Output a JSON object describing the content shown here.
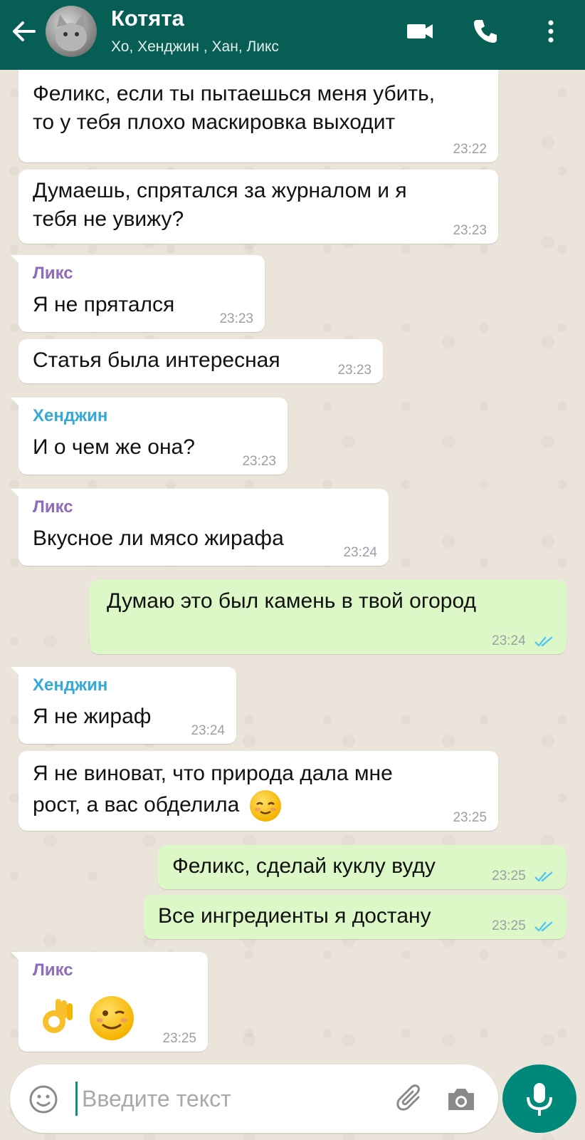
{
  "header": {
    "title": "Котята",
    "members": "Хо, Хенджин , Хан, Ликс"
  },
  "messages": [
    {
      "dir": "in",
      "sender": "",
      "text_lines": [
        "Феликс, если ты пытаешься меня убить,",
        "то у тебя плохо маскировка выходит"
      ],
      "time": "23:22"
    },
    {
      "dir": "in",
      "sender": "",
      "text_lines": [
        "Думаешь, спрятался за журналом и я",
        "тебя не увижу?"
      ],
      "time": "23:23"
    },
    {
      "dir": "in",
      "sender": "Ликс",
      "text_lines": [
        "Я не прятался"
      ],
      "time": "23:23"
    },
    {
      "dir": "in",
      "sender": "",
      "text_lines": [
        "Статья была интересная"
      ],
      "time": "23:23"
    },
    {
      "dir": "in",
      "sender": "Хенджин",
      "text_lines": [
        "И о чем же она?"
      ],
      "time": "23:23"
    },
    {
      "dir": "in",
      "sender": "Ликс",
      "text_lines": [
        "Вкусное ли мясо жирафа"
      ],
      "time": "23:24"
    },
    {
      "dir": "out",
      "sender": "",
      "text_lines": [
        "Думаю это был камень в твой огород"
      ],
      "time": "23:24"
    },
    {
      "dir": "in",
      "sender": "Хенджин",
      "text_lines": [
        "Я не жираф"
      ],
      "time": "23:24"
    },
    {
      "dir": "in",
      "sender": "",
      "text_lines": [
        "Я не виноват, что природа дала мне",
        "рост, а вас обделила"
      ],
      "time": "23:25",
      "emoji": "relieved-face-emoji"
    },
    {
      "dir": "out",
      "sender": "",
      "text_lines": [
        "Феликс, сделай куклу вуду"
      ],
      "time": "23:25"
    },
    {
      "dir": "out",
      "sender": "",
      "text_lines": [
        "Все ингредиенты я достану"
      ],
      "time": "23:25"
    },
    {
      "dir": "in",
      "sender": "Ликс",
      "text_lines": [],
      "time": "23:25",
      "emoji": [
        "ok-hand-emoji",
        "winking-face-emoji"
      ]
    }
  ],
  "input": {
    "placeholder": "Введите текст"
  },
  "colors": {
    "header": "#075e54",
    "incoming_bubble": "#ffffff",
    "outgoing_bubble": "#dcf8c6",
    "sender_lix": "#8e6cb8",
    "sender_hyunjin": "#35a9d8",
    "read_ticks": "#4fc3f7",
    "mic_button": "#00897b"
  },
  "icons": [
    "back-arrow-icon",
    "video-call-icon",
    "phone-icon",
    "more-vert-icon",
    "emoji-icon",
    "paperclip-icon",
    "camera-icon",
    "microphone-icon"
  ]
}
